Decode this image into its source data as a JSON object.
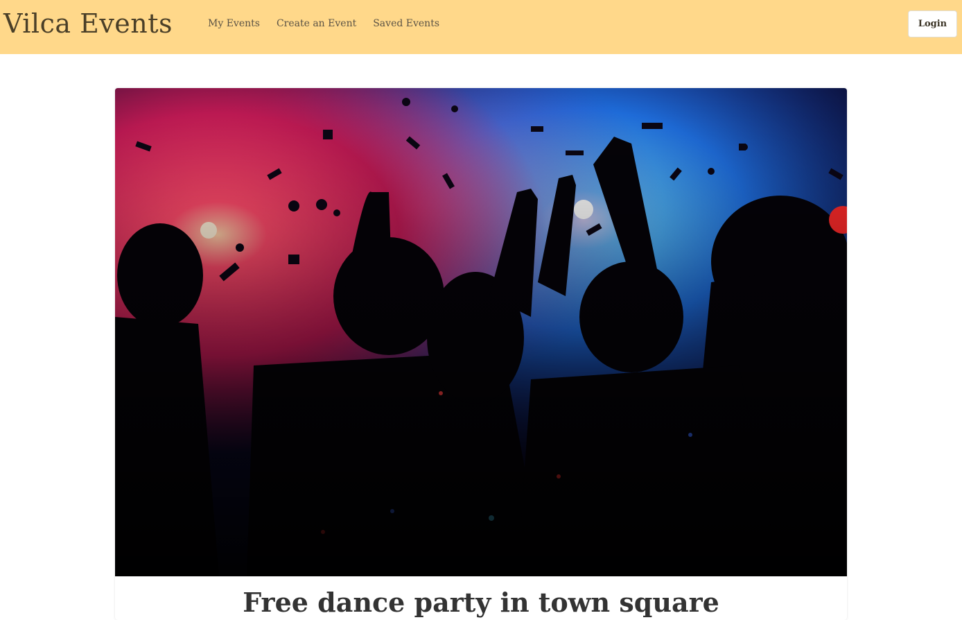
{
  "navbar": {
    "brand": "Vilca Events",
    "links": [
      {
        "label": "My Events"
      },
      {
        "label": "Create an Event"
      },
      {
        "label": "Saved Events"
      }
    ],
    "login_label": "Login",
    "background_color": "#ffd88a"
  },
  "event": {
    "title": "Free dance party in town square",
    "image_icon": "party-crowd-photo"
  }
}
